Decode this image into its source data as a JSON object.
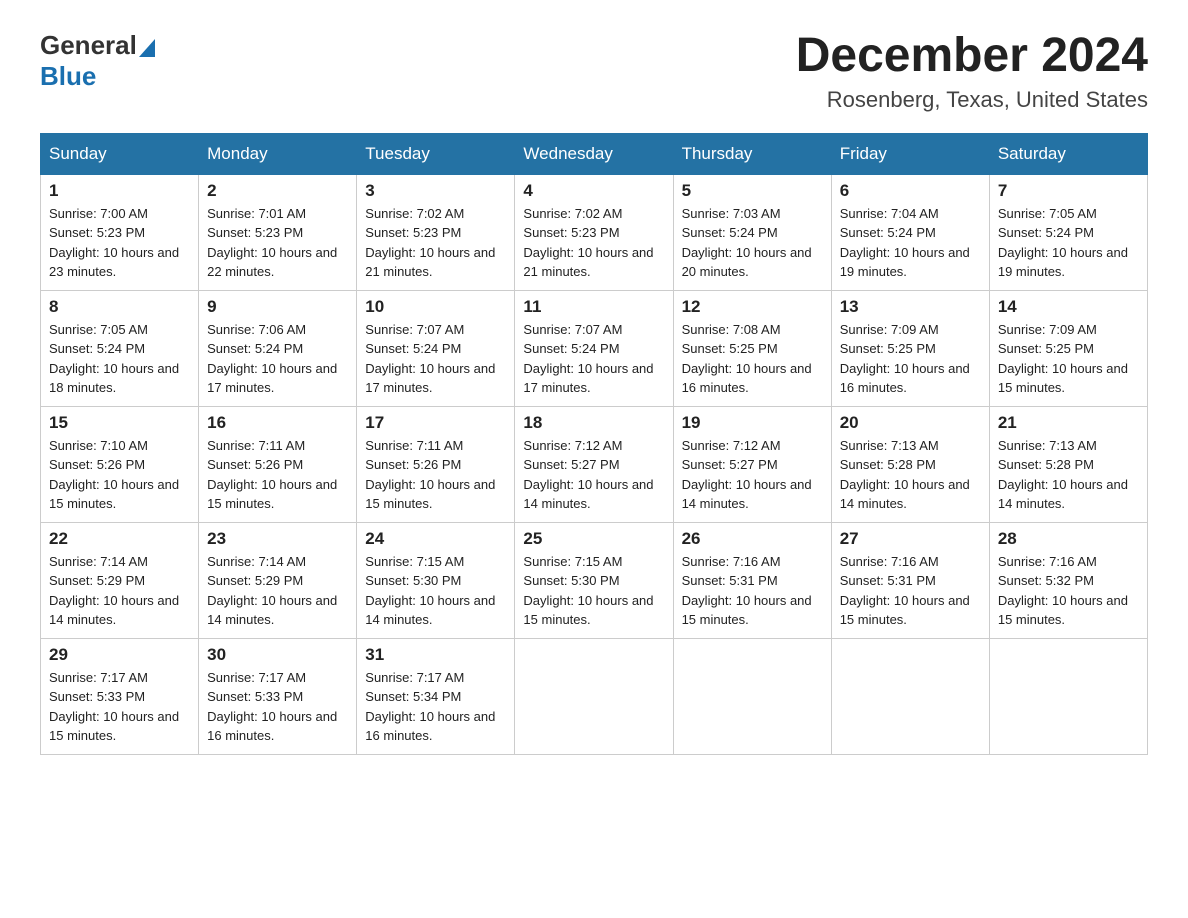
{
  "header": {
    "logo_general": "General",
    "logo_blue": "Blue",
    "month_title": "December 2024",
    "location": "Rosenberg, Texas, United States"
  },
  "days_of_week": [
    "Sunday",
    "Monday",
    "Tuesday",
    "Wednesday",
    "Thursday",
    "Friday",
    "Saturday"
  ],
  "weeks": [
    [
      {
        "day": "1",
        "sunrise": "7:00 AM",
        "sunset": "5:23 PM",
        "daylight": "10 hours and 23 minutes."
      },
      {
        "day": "2",
        "sunrise": "7:01 AM",
        "sunset": "5:23 PM",
        "daylight": "10 hours and 22 minutes."
      },
      {
        "day": "3",
        "sunrise": "7:02 AM",
        "sunset": "5:23 PM",
        "daylight": "10 hours and 21 minutes."
      },
      {
        "day": "4",
        "sunrise": "7:02 AM",
        "sunset": "5:23 PM",
        "daylight": "10 hours and 21 minutes."
      },
      {
        "day": "5",
        "sunrise": "7:03 AM",
        "sunset": "5:24 PM",
        "daylight": "10 hours and 20 minutes."
      },
      {
        "day": "6",
        "sunrise": "7:04 AM",
        "sunset": "5:24 PM",
        "daylight": "10 hours and 19 minutes."
      },
      {
        "day": "7",
        "sunrise": "7:05 AM",
        "sunset": "5:24 PM",
        "daylight": "10 hours and 19 minutes."
      }
    ],
    [
      {
        "day": "8",
        "sunrise": "7:05 AM",
        "sunset": "5:24 PM",
        "daylight": "10 hours and 18 minutes."
      },
      {
        "day": "9",
        "sunrise": "7:06 AM",
        "sunset": "5:24 PM",
        "daylight": "10 hours and 17 minutes."
      },
      {
        "day": "10",
        "sunrise": "7:07 AM",
        "sunset": "5:24 PM",
        "daylight": "10 hours and 17 minutes."
      },
      {
        "day": "11",
        "sunrise": "7:07 AM",
        "sunset": "5:24 PM",
        "daylight": "10 hours and 17 minutes."
      },
      {
        "day": "12",
        "sunrise": "7:08 AM",
        "sunset": "5:25 PM",
        "daylight": "10 hours and 16 minutes."
      },
      {
        "day": "13",
        "sunrise": "7:09 AM",
        "sunset": "5:25 PM",
        "daylight": "10 hours and 16 minutes."
      },
      {
        "day": "14",
        "sunrise": "7:09 AM",
        "sunset": "5:25 PM",
        "daylight": "10 hours and 15 minutes."
      }
    ],
    [
      {
        "day": "15",
        "sunrise": "7:10 AM",
        "sunset": "5:26 PM",
        "daylight": "10 hours and 15 minutes."
      },
      {
        "day": "16",
        "sunrise": "7:11 AM",
        "sunset": "5:26 PM",
        "daylight": "10 hours and 15 minutes."
      },
      {
        "day": "17",
        "sunrise": "7:11 AM",
        "sunset": "5:26 PM",
        "daylight": "10 hours and 15 minutes."
      },
      {
        "day": "18",
        "sunrise": "7:12 AM",
        "sunset": "5:27 PM",
        "daylight": "10 hours and 14 minutes."
      },
      {
        "day": "19",
        "sunrise": "7:12 AM",
        "sunset": "5:27 PM",
        "daylight": "10 hours and 14 minutes."
      },
      {
        "day": "20",
        "sunrise": "7:13 AM",
        "sunset": "5:28 PM",
        "daylight": "10 hours and 14 minutes."
      },
      {
        "day": "21",
        "sunrise": "7:13 AM",
        "sunset": "5:28 PM",
        "daylight": "10 hours and 14 minutes."
      }
    ],
    [
      {
        "day": "22",
        "sunrise": "7:14 AM",
        "sunset": "5:29 PM",
        "daylight": "10 hours and 14 minutes."
      },
      {
        "day": "23",
        "sunrise": "7:14 AM",
        "sunset": "5:29 PM",
        "daylight": "10 hours and 14 minutes."
      },
      {
        "day": "24",
        "sunrise": "7:15 AM",
        "sunset": "5:30 PM",
        "daylight": "10 hours and 14 minutes."
      },
      {
        "day": "25",
        "sunrise": "7:15 AM",
        "sunset": "5:30 PM",
        "daylight": "10 hours and 15 minutes."
      },
      {
        "day": "26",
        "sunrise": "7:16 AM",
        "sunset": "5:31 PM",
        "daylight": "10 hours and 15 minutes."
      },
      {
        "day": "27",
        "sunrise": "7:16 AM",
        "sunset": "5:31 PM",
        "daylight": "10 hours and 15 minutes."
      },
      {
        "day": "28",
        "sunrise": "7:16 AM",
        "sunset": "5:32 PM",
        "daylight": "10 hours and 15 minutes."
      }
    ],
    [
      {
        "day": "29",
        "sunrise": "7:17 AM",
        "sunset": "5:33 PM",
        "daylight": "10 hours and 15 minutes."
      },
      {
        "day": "30",
        "sunrise": "7:17 AM",
        "sunset": "5:33 PM",
        "daylight": "10 hours and 16 minutes."
      },
      {
        "day": "31",
        "sunrise": "7:17 AM",
        "sunset": "5:34 PM",
        "daylight": "10 hours and 16 minutes."
      },
      null,
      null,
      null,
      null
    ]
  ]
}
